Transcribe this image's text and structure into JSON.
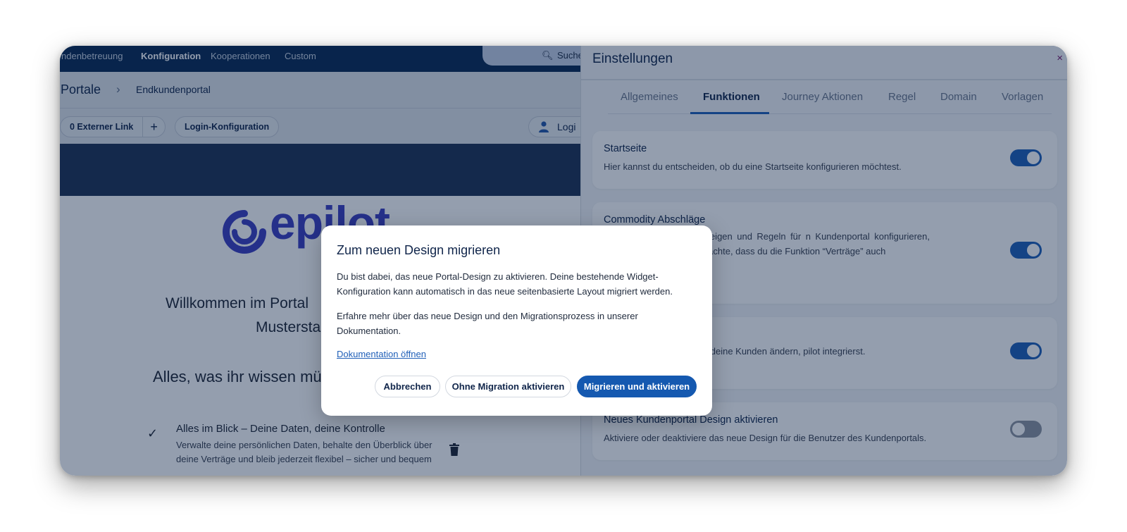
{
  "topnav": {
    "items": [
      "ndenbetreuung",
      "Konfiguration",
      "Kooperationen",
      "Custom"
    ],
    "active_index": 1,
    "search_placeholder": "Suche"
  },
  "breadcrumb": {
    "root": "Portale",
    "separator": "›",
    "child": "Endkundenportal"
  },
  "toolbar": {
    "external_link": "0 Externer Link",
    "add": "+",
    "login_config": "Login-Konfiguration",
    "login_preview": "Logi"
  },
  "preview": {
    "logo_text": "epilot",
    "welcome_line1": "Willkommen im Portal",
    "welcome_line2": "Mustersta",
    "heading": "Alles, was ihr wissen mü",
    "feature_title": "Alles im Blick – Deine Daten, deine Kontrolle",
    "feature_desc": "Verwalte deine persönlichen Daten, behalte den Überblick über deine Verträge und bleib jederzeit flexibel – sicher und bequem"
  },
  "drawer": {
    "title": "Einstellungen",
    "close": "×",
    "tabs": [
      "Allgemeines",
      "Funktionen",
      "Journey Aktionen",
      "Regel",
      "Domain",
      "Vorlagen"
    ],
    "active_tab": 1,
    "cards": [
      {
        "title": "Startseite",
        "desc": "Hier kannst du entscheiden, ob du eine Startseite konfigurieren möchtest.",
        "enabled": true
      },
      {
        "title": "Commodity Abschläge",
        "desc": "st du Zahlungsdaten anzeigen und Regeln für n Kundenportal konfigurieren, wenn du dein ERP- tte beachte, dass du die Funktion “Verträge” auch",
        "enabled": true
      },
      {
        "title": "",
        "desc": "u das Fälligkeitsdatum für deine Kunden ändern, pilot integrierst.",
        "enabled": true
      },
      {
        "title": "Neues Kundenportal Design aktivieren",
        "desc": "Aktiviere oder deaktiviere das neue Design für die Benutzer des Kundenportals.",
        "enabled": false
      }
    ]
  },
  "modal": {
    "title": "Zum neuen Design migrieren",
    "para1": "Du bist dabei, das neue Portal-Design zu aktivieren. Deine bestehende Widget-Konfiguration kann automatisch in das neue seitenbasierte Layout migriert werden.",
    "para2": "Erfahre mehr über das neue Design und den Migrationsprozess in unserer Dokumentation.",
    "link": "Dokumentation öffnen",
    "btn_cancel": "Abbrechen",
    "btn_no_migration": "Ohne Migration aktivieren",
    "btn_migrate": "Migrieren und aktivieren"
  },
  "colors": {
    "nav": "#0a2a53",
    "accent": "#1f5fb8",
    "primary_button": "#1559b0",
    "logo": "#3c3fc0",
    "overlay": "rgba(8,30,68,0.43)"
  }
}
